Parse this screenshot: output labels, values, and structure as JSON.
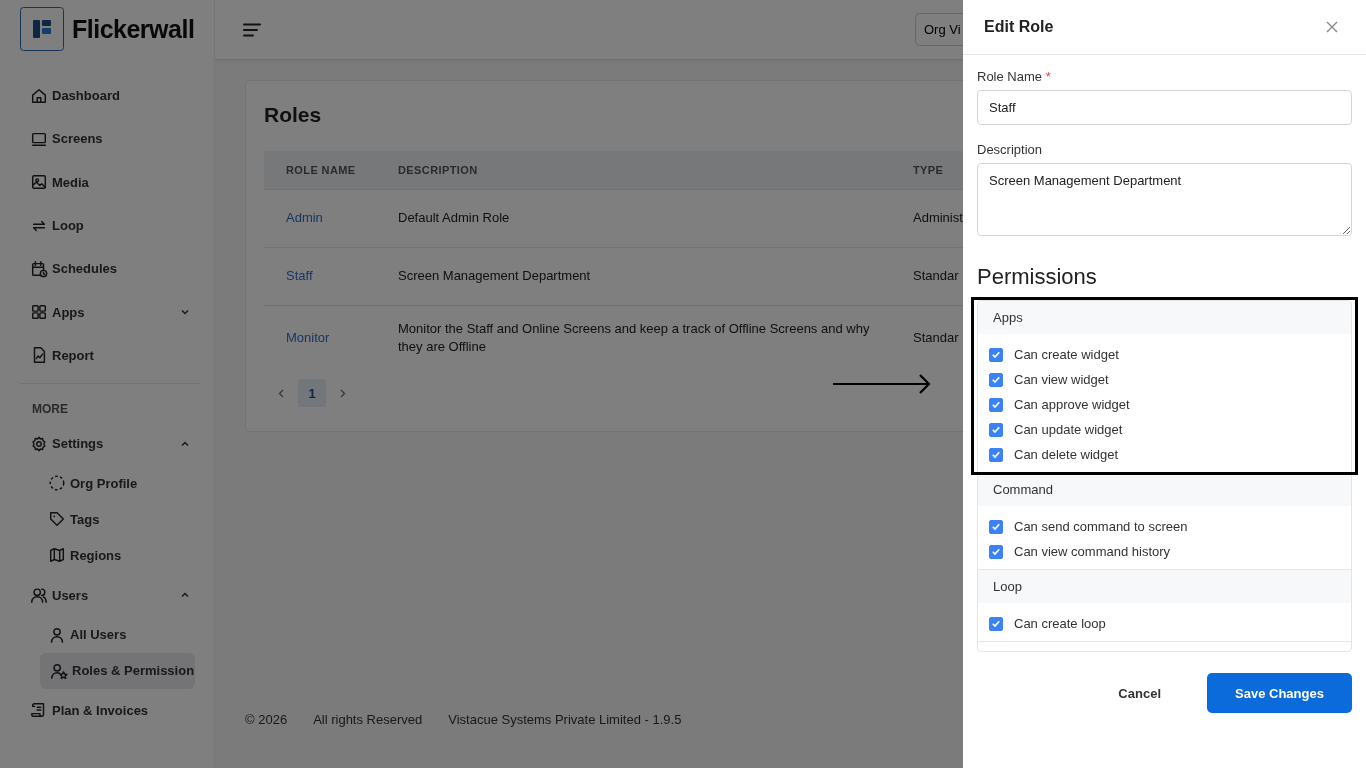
{
  "brand": {
    "name": "Flickerwall"
  },
  "sidebar": {
    "items": [
      {
        "label": "Dashboard",
        "selected": false
      },
      {
        "label": "Screens",
        "selected": false
      },
      {
        "label": "Media",
        "selected": false
      },
      {
        "label": "Loop",
        "selected": false
      },
      {
        "label": "Schedules",
        "selected": false
      },
      {
        "label": "Apps",
        "selected": false,
        "expanded": false
      },
      {
        "label": "Report",
        "selected": false
      }
    ],
    "section_label": "MORE",
    "more_items": [
      {
        "label": "Settings",
        "selected": false,
        "expanded": true,
        "children": [
          {
            "label": "Org Profile",
            "selected": false
          },
          {
            "label": "Tags",
            "selected": false
          },
          {
            "label": "Regions",
            "selected": false
          }
        ]
      },
      {
        "label": "Users",
        "selected": false,
        "expanded": true,
        "children": [
          {
            "label": "All Users",
            "selected": false
          },
          {
            "label": "Roles & Permission",
            "selected": true
          }
        ]
      },
      {
        "label": "Plan & Invoices",
        "selected": false
      }
    ]
  },
  "header": {
    "org_button": "Org Vi"
  },
  "page": {
    "title": "Roles",
    "table": {
      "columns": [
        "ROLE NAME",
        "DESCRIPTION",
        "TYPE"
      ],
      "rows": [
        {
          "name": "Admin",
          "description": "Default Admin Role",
          "type": "Administ"
        },
        {
          "name": "Staff",
          "description": "Screen Management Department",
          "type": "Standar"
        },
        {
          "name": "Monitor",
          "description": "Monitor the Staff and Online Screens and keep a track of Offline Screens and why they are Offline",
          "type": "Standar"
        }
      ]
    },
    "pagination": {
      "pages": [
        {
          "label": "1",
          "selected": true
        }
      ]
    }
  },
  "footer": [
    "© 2026",
    "All rights Reserved",
    "Vistacue Systems Private Limited - 1.9.5"
  ],
  "drawer": {
    "title": "Edit Role",
    "role_name": {
      "label": "Role Name",
      "required_mark": "*",
      "value": "Staff"
    },
    "description": {
      "label": "Description",
      "value": "Screen Management Department"
    },
    "permissions_title": "Permissions",
    "groups": [
      {
        "title": "Apps",
        "highlighted": true,
        "items": [
          {
            "label": "Can create widget",
            "checked": true
          },
          {
            "label": "Can view widget",
            "checked": true
          },
          {
            "label": "Can approve widget",
            "checked": true
          },
          {
            "label": "Can update widget",
            "checked": true
          },
          {
            "label": "Can delete widget",
            "checked": true
          }
        ]
      },
      {
        "title": "Command",
        "highlighted": false,
        "items": [
          {
            "label": "Can send command to screen",
            "checked": true
          },
          {
            "label": "Can view command history",
            "checked": true
          }
        ]
      },
      {
        "title": "Loop",
        "highlighted": false,
        "items": [
          {
            "label": "Can create loop",
            "checked": true
          }
        ]
      }
    ],
    "buttons": {
      "cancel": "Cancel",
      "save": "Save Changes"
    }
  },
  "annotations": [
    {
      "kind": "arrow"
    }
  ]
}
